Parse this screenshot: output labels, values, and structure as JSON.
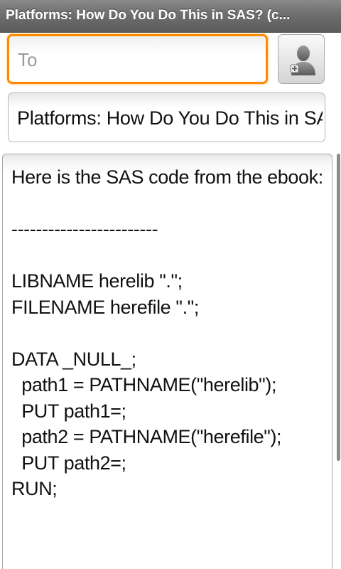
{
  "titlebar": {
    "title": "Platforms: How Do You Do This in SAS? (c..."
  },
  "compose": {
    "to_placeholder": "To",
    "to_value": "",
    "subject": "Platforms: How Do You Do This in SAS?",
    "body": "Here is the SAS code from the ebook:\n\n------------------------\n\nLIBNAME herelib \".\";\nFILENAME herefile \".\";\n\nDATA _NULL_;\n  path1 = PATHNAME(\"herelib\");\n  PUT path1=;\n  path2 = PATHNAME(\"herefile\");\n  PUT path2=;\nRUN;"
  },
  "icons": {
    "contact_button": "add-contact-icon"
  },
  "colors": {
    "focus_border": "#ff8a00",
    "titlebar_bg": "#6e6e6e"
  }
}
